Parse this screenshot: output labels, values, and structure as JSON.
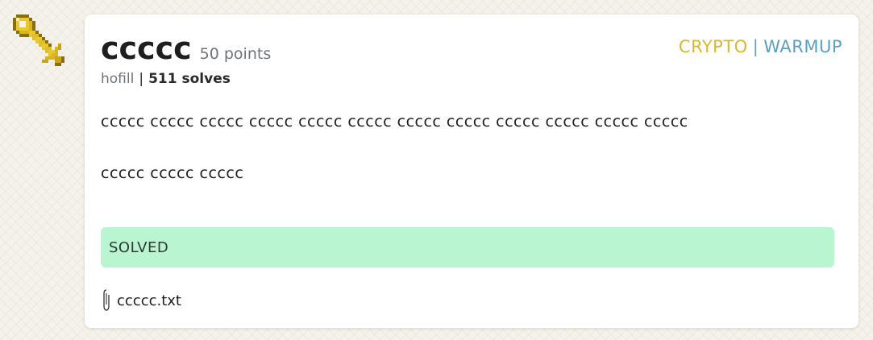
{
  "challenge": {
    "title": "ccccc",
    "points": "50 points",
    "author": "hofill",
    "meta_separator": "|",
    "solves": "511 solves",
    "categories": {
      "first": "CRYPTO",
      "separator": "|",
      "second": "WARMUP"
    },
    "description": [
      "ccccc ccccc ccccc ccccc ccccc ccccc ccccc ccccc ccccc ccccc ccccc ccccc",
      "ccccc ccccc ccccc"
    ],
    "status": "SOLVED",
    "attachment": "ccccc.txt"
  },
  "colors": {
    "crypto": "#d8b92c",
    "warmup": "#5aa0bf",
    "solved_bg": "#b9f5d0",
    "key": "#e0c02a"
  },
  "icons": {
    "category_icon": "key-icon",
    "file_icon": "paperclip-icon"
  }
}
